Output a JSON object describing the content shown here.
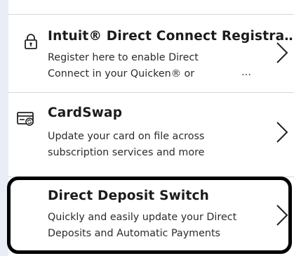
{
  "items": [
    {
      "icon": "lock-icon",
      "title": "Intuit® Direct Connect Registra…",
      "desc_line1": "Register here to enable Direct",
      "desc_line2": "Connect in your Quicken® or",
      "more": "…"
    },
    {
      "icon": "card-swap-icon",
      "title": "CardSwap",
      "desc_line1": "Update your card on file across",
      "desc_line2": "subscription services and more"
    },
    {
      "icon": "",
      "title": "Direct Deposit Switch",
      "desc_line1": "Quickly and easily update your Direct",
      "desc_line2": "Deposits and Automatic Payments",
      "highlighted": true
    }
  ],
  "colors": {
    "highlight_border": "#000000",
    "divider": "#d7d7d7",
    "text": "#222222"
  }
}
